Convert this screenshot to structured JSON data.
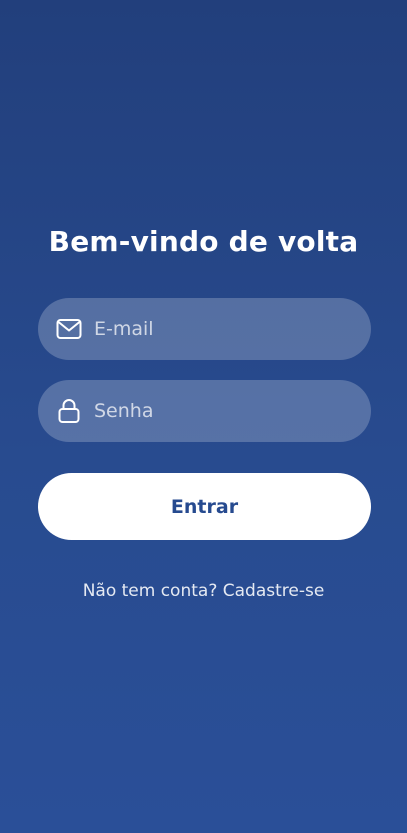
{
  "login": {
    "title": "Bem-vindo de volta",
    "email": {
      "placeholder": "E-mail",
      "value": "",
      "icon": "mail-icon"
    },
    "password": {
      "placeholder": "Senha",
      "value": "",
      "icon": "lock-icon"
    },
    "submit_label": "Entrar",
    "signup_prompt": "Não tem conta?",
    "signup_link": "Cadastre-se"
  },
  "colors": {
    "background_top": "#223f7c",
    "background_bottom": "#2a4f98",
    "button_background": "#ffffff",
    "button_text": "#264a8f"
  }
}
